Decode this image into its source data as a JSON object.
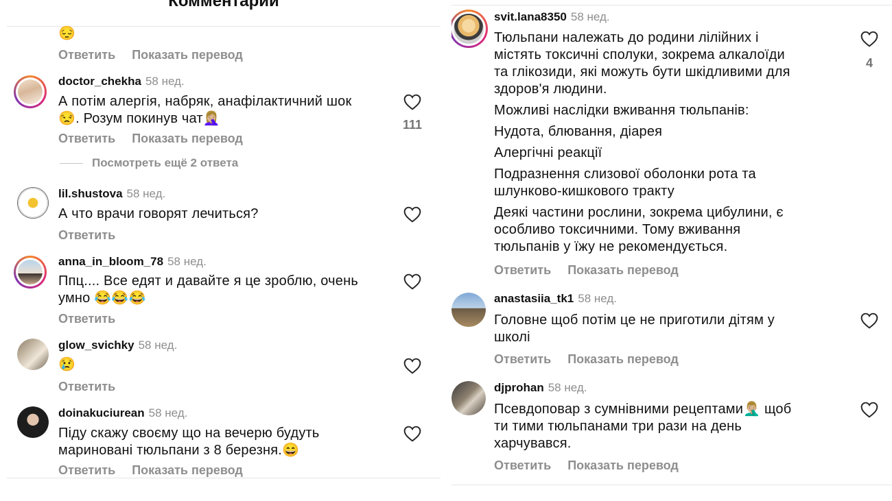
{
  "header": {
    "title": "Комментарии"
  },
  "left": {
    "top_emoji": "😔",
    "top_actions": {
      "reply": "Ответить",
      "translate": "Показать перевод"
    },
    "comments": [
      {
        "user": "doctor_chekha",
        "time": "58 нед.",
        "lines": [
          "А потім алергія, набряк, анафілактичний шок",
          "😒. Розум покинув чат🤦🏼‍♀️"
        ],
        "likes": "111",
        "reply": "Ответить",
        "translate": "Показать перевод",
        "more": "Посмотреть ещё 2 ответа"
      },
      {
        "user": "lil.shustova",
        "time": "58 нед.",
        "lines": [
          "А что врачи говорят лечиться?"
        ],
        "reply": "Ответить"
      },
      {
        "user": "anna_in_bloom_78",
        "time": "58 нед.",
        "lines": [
          "Ппц.... Все едят и давайте я це зроблю, очень",
          "умно 😂😂😂"
        ],
        "reply": "Ответить"
      },
      {
        "user": "glow_svichky",
        "time": "58 нед.",
        "lines": [
          "😢"
        ],
        "reply": "Ответить"
      },
      {
        "user": "doinakuciurean",
        "time": "58 нед.",
        "lines": [
          "Піду скажу своєму що на вечерю будуть",
          "мариновані тюльпани з 8 березня.😄"
        ],
        "reply": "Ответить",
        "translate": "Показать перевод"
      }
    ]
  },
  "right": {
    "comments": [
      {
        "user": "svit.lana8350",
        "time": "58 нед.",
        "lines": [
          "Тюльпани належать до родини лілійних і",
          "містять токсичні сполуки, зокрема алкалоїди",
          "та глікозиди, які можуть бути шкідливими для",
          "здоров'я людини.",
          "Можливі наслідки вживання тюльпанів:",
          "Нудота, блювання, діарея",
          "Алергічні реакції",
          "Подразнення слизової оболонки рота та",
          "шлунково-кишкового тракту",
          "Деякі частини рослини, зокрема цибулини, є",
          "особливо токсичними. Тому вживання",
          "тюльпанів у їжу не рекомендується."
        ],
        "likes": "4",
        "reply": "Ответить",
        "translate": "Показать перевод"
      },
      {
        "user": "anastasiia_tk1",
        "time": "58 нед.",
        "lines": [
          "Головне щоб потім це не приготили дітям у",
          "школі"
        ],
        "reply": "Ответить",
        "translate": "Показать перевод"
      },
      {
        "user": "djprohan",
        "time": "58 нед.",
        "lines": [
          "Псевдоповар з сумнівними рецептами🤦🏼‍♂️ щоб",
          "ти тими тюльпанами три рази на день",
          "харчувався."
        ],
        "reply": "Ответить",
        "translate": "Показать перевод"
      }
    ]
  },
  "icons": {
    "like": "heart-outline-icon"
  }
}
